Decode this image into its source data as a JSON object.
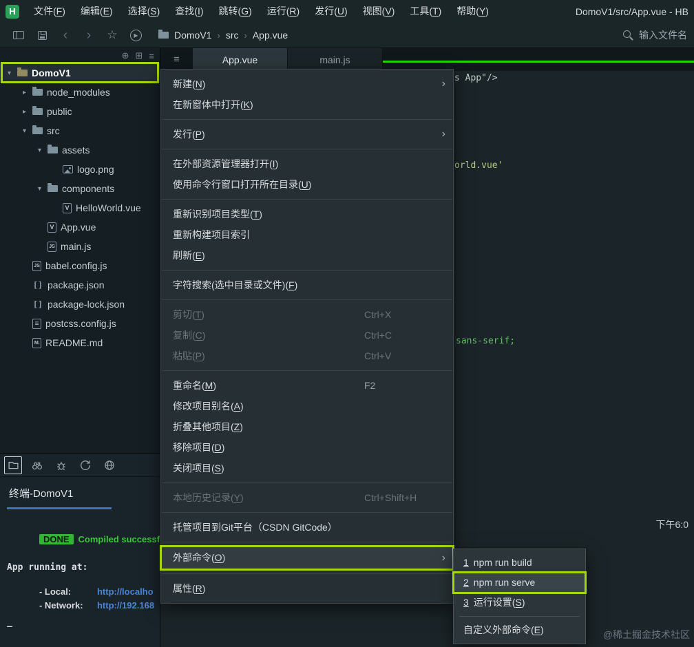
{
  "colors": {
    "annotation_green": "#a6d70a",
    "editor_accent_green": "#28d400",
    "terminal_tab_underline": "#3b76c0",
    "done_badge_bg": "#35b535"
  },
  "menubar": {
    "logo_text": "H",
    "items": [
      {
        "label": "文件(F)"
      },
      {
        "label": "编辑(E)"
      },
      {
        "label": "选择(S)"
      },
      {
        "label": "查找(I)"
      },
      {
        "label": "跳转(G)"
      },
      {
        "label": "运行(R)"
      },
      {
        "label": "发行(U)"
      },
      {
        "label": "视图(V)"
      },
      {
        "label": "工具(T)"
      },
      {
        "label": "帮助(Y)"
      }
    ],
    "window_title": "DomoV1/src/App.vue - HB"
  },
  "toolbar": {
    "breadcrumb": {
      "project": "DomoV1",
      "folder": "src",
      "file": "App.vue"
    },
    "file_search_label": "输入文件名"
  },
  "editor": {
    "tabs": [
      {
        "label": "App.vue"
      },
      {
        "label": "main.js"
      }
    ],
    "code_fragments": [
      {
        "text": "s App\"/>"
      },
      {
        "text": "orld.vue'"
      },
      {
        "text": "sans-serif;"
      }
    ]
  },
  "file_tree": {
    "items": [
      {
        "label": "DomoV1"
      },
      {
        "label": "node_modules"
      },
      {
        "label": "public"
      },
      {
        "label": "src"
      },
      {
        "label": "assets"
      },
      {
        "label": "logo.png"
      },
      {
        "label": "components"
      },
      {
        "label": "HelloWorld.vue"
      },
      {
        "label": "App.vue"
      },
      {
        "label": "main.js"
      },
      {
        "label": "babel.config.js"
      },
      {
        "label": "package.json"
      },
      {
        "label": "package-lock.json"
      },
      {
        "label": "postcss.config.js"
      },
      {
        "label": "README.md"
      }
    ]
  },
  "context_menu": {
    "items": [
      {
        "label": "新建(N)"
      },
      {
        "label": "在新窗体中打开(K)"
      },
      {
        "label": "发行(P)"
      },
      {
        "label": "在外部资源管理器打开(I)"
      },
      {
        "label": "使用命令行窗口打开所在目录(U)"
      },
      {
        "label": "重新识别项目类型(T)"
      },
      {
        "label": "重新构建项目索引"
      },
      {
        "label": "刷新(E)"
      },
      {
        "label": "字符搜索(选中目录或文件)(F)"
      },
      {
        "label": "剪切(T)",
        "shortcut": "Ctrl+X"
      },
      {
        "label": "复制(C)",
        "shortcut": "Ctrl+C"
      },
      {
        "label": "粘贴(P)",
        "shortcut": "Ctrl+V"
      },
      {
        "label": "重命名(M)",
        "shortcut": "F2"
      },
      {
        "label": "修改项目别名(A)"
      },
      {
        "label": "折叠其他项目(Z)"
      },
      {
        "label": "移除项目(D)"
      },
      {
        "label": "关闭项目(S)"
      },
      {
        "label": "本地历史记录(Y)",
        "shortcut": "Ctrl+Shift+H"
      },
      {
        "label": "托管项目到Git平台（CSDN GitCode）"
      },
      {
        "label": "外部命令(O)"
      },
      {
        "label": "属性(R)"
      }
    ]
  },
  "external_commands_submenu": {
    "items": [
      {
        "num": "1",
        "label": "npm run build"
      },
      {
        "num": "2",
        "label": "npm run serve"
      },
      {
        "num": "3",
        "label": "运行设置(S)"
      },
      {
        "label": "自定义外部命令(E)"
      }
    ]
  },
  "bottom_panel": {
    "terminal_tab": "终端-DomoV1",
    "terminal": {
      "done_badge": "DONE",
      "compile_message": "Compiled successfull",
      "running_header": "App running at:",
      "local_label": "- Local:",
      "local_url": "http://localho",
      "network_label": "- Network:",
      "network_url": "http://192.168",
      "cursor": "_"
    }
  },
  "status": {
    "time": "下午6:0"
  },
  "watermark": "@稀土掘金技术社区"
}
